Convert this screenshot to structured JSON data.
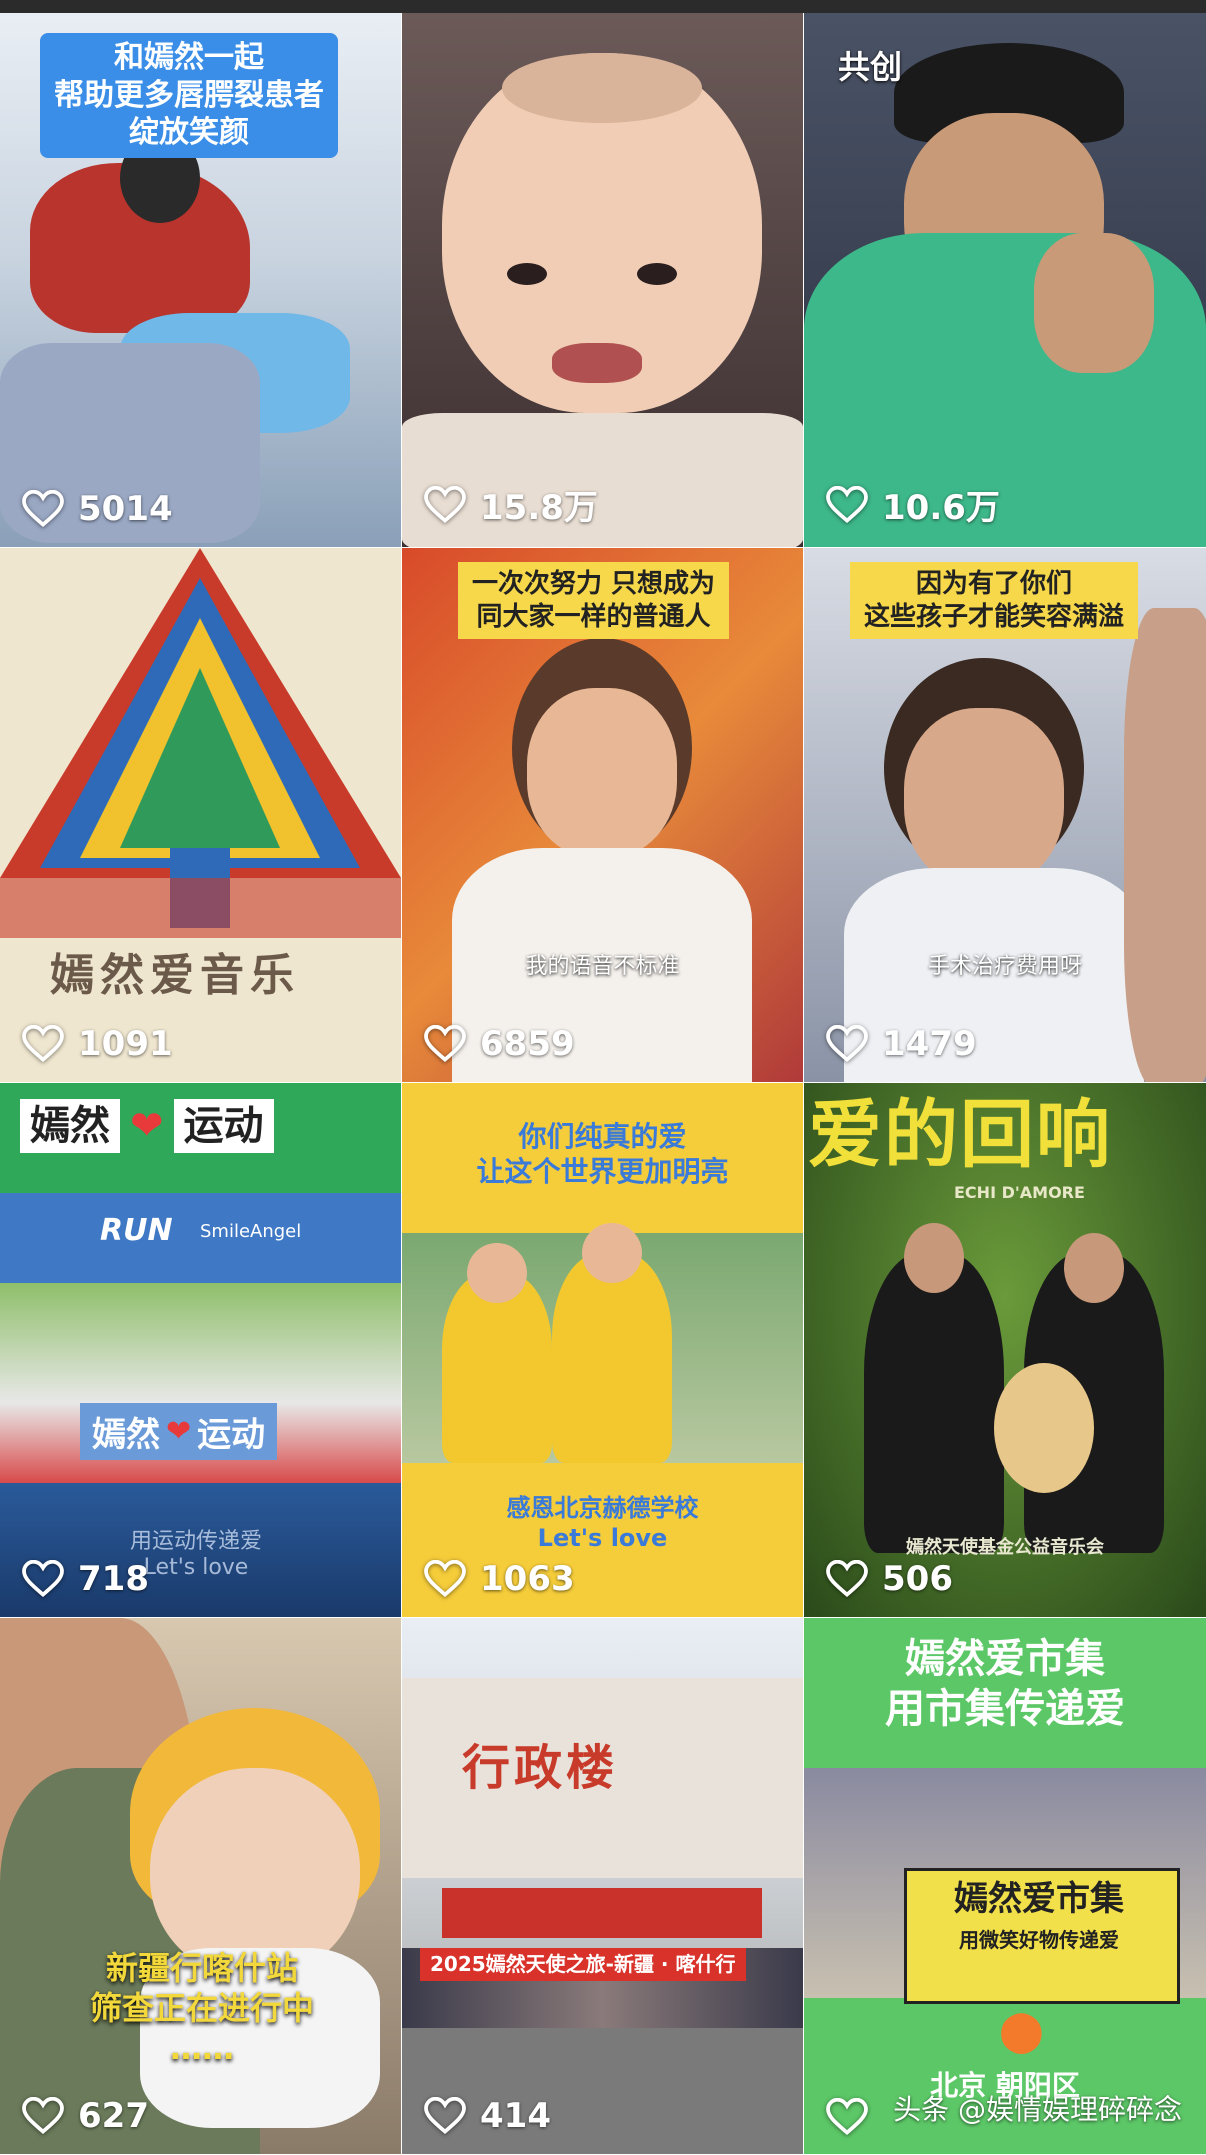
{
  "tiles": [
    {
      "caption": "和嫣然一起\n帮助更多唇腭裂患者\n绽放笑颜",
      "likes": "5014"
    },
    {
      "caption": "",
      "likes": "15.8万"
    },
    {
      "caption": "共创",
      "likes": "10.6万"
    },
    {
      "caption": "嫣然爱音乐",
      "likes": "1091"
    },
    {
      "caption": "一次次努力 只想成为\n同大家一样的普通人",
      "subtitle": "我的语音不标准",
      "likes": "6859"
    },
    {
      "caption": "因为有了你们\n这些孩子才能笑容满溢",
      "subtitle": "手术治疗费用呀",
      "likes": "1479"
    },
    {
      "caption_left": "嫣然",
      "caption_right": "运动",
      "brand": "RUN",
      "brand2": "SmileAngel",
      "banner_left": "嫣然",
      "banner_right": "运动",
      "footer": "用运动传递爱\nLet's love",
      "likes": "718"
    },
    {
      "caption": "你们纯真的爱\n让这个世界更加明亮",
      "footer": "感恩北京赫德学校\nLet's love",
      "likes": "1063"
    },
    {
      "caption": "爱的回响",
      "sub": "ECHI D'AMORE",
      "footer": "嫣然天使基金公益音乐会",
      "likes": "506"
    },
    {
      "caption": "新疆行喀什站\n筛查正在进行中\n……",
      "likes": "627"
    },
    {
      "caption": "行政楼",
      "banner": "2025嫣然天使之旅-新疆 · 喀什行",
      "likes": "414"
    },
    {
      "caption": "嫣然爱市集\n用市集传递爱",
      "banner": "嫣然爱市集",
      "banner_sub": "用微笑好物传递爱",
      "place": "北京 朝阳区",
      "likes": ""
    }
  ],
  "watermark": "头条 @娱情娱理碎碎念",
  "colors": {
    "blue": "#3a8ee8",
    "yellow": "#f7d84a",
    "green": "#5cc767"
  }
}
